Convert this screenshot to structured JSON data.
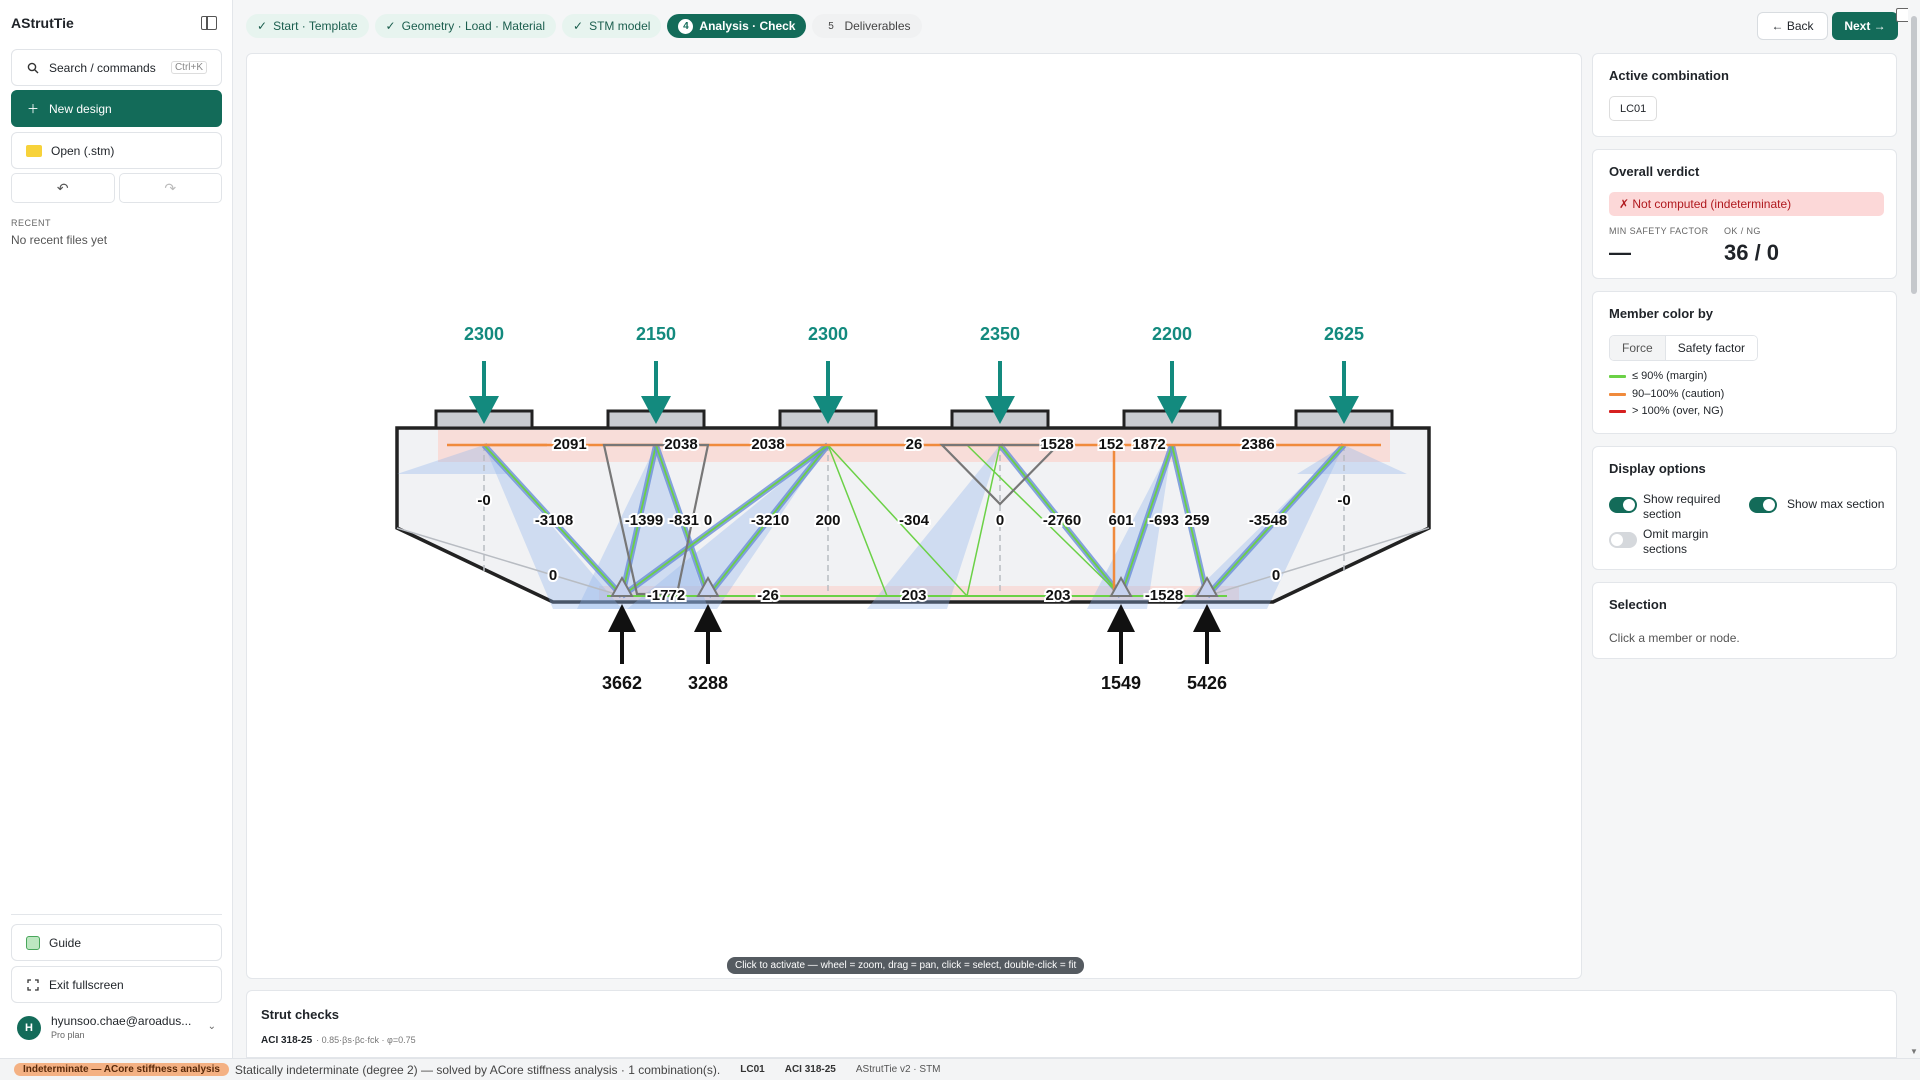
{
  "sidebar": {
    "brand": "AStrutTie",
    "search_label": "Search / commands",
    "search_shortcut": "Ctrl+K",
    "new_design_label": "New design",
    "open_label": "Open (.stm)",
    "recent_heading": "RECENT",
    "recent_empty": "No recent files yet",
    "guide_label": "Guide",
    "exit_fullscreen_label": "Exit fullscreen",
    "user": {
      "initial": "H",
      "email": "hyunsoo.chae@aroadus...",
      "plan": "Pro plan"
    }
  },
  "steps": [
    {
      "label": "Start · Template",
      "mark": "✓",
      "state": "done"
    },
    {
      "label": "Geometry · Load · Material",
      "mark": "✓",
      "state": "done"
    },
    {
      "label": "STM model",
      "mark": "✓",
      "state": "done"
    },
    {
      "label": "Analysis · Check",
      "mark": "4",
      "state": "active"
    },
    {
      "label": "Deliverables",
      "mark": "5",
      "state": "todo"
    }
  ],
  "nav": {
    "back_label": "← Back",
    "next_label": "Next →"
  },
  "canvas": {
    "hint": "Click to activate — wheel = zoom, drag = pan, click = select, double-click = fit",
    "loads": [
      "2300",
      "2150",
      "2300",
      "2350",
      "2200",
      "2625"
    ],
    "reactions": [
      "3662",
      "3288",
      "1549",
      "5426"
    ],
    "top_chord_forces": [
      "2091",
      "2038",
      "2038",
      "26",
      "1528",
      "152",
      "1872",
      "2386"
    ],
    "web_forces": [
      "-0",
      "-3108",
      "-1399",
      "-831",
      "0",
      "-3210",
      "200",
      "-304",
      "0",
      "-2760",
      "601",
      "-693",
      "259",
      "-3548",
      "-0"
    ],
    "bottom_chord_forces": [
      "0",
      "-1772",
      "-26",
      "203",
      "203",
      "-1528",
      "0"
    ]
  },
  "panel": {
    "active_combination": {
      "title": "Active combination",
      "value": "LC01"
    },
    "verdict": {
      "title": "Overall verdict",
      "badge": "✗ Not computed (indeterminate)",
      "min_sf_label": "MIN SAFETY FACTOR",
      "min_sf_value": "—",
      "okng_label": "OK / NG",
      "okng_value": "36 / 0"
    },
    "member_color": {
      "title": "Member color by",
      "options": [
        "Force",
        "Safety factor"
      ],
      "selected": "Safety factor",
      "legend": [
        {
          "label": "≤ 90% (margin)",
          "color": "#6bd146"
        },
        {
          "label": "90–100% (caution)",
          "color": "#f08a3c"
        },
        {
          "label": "> 100% (over, NG)",
          "color": "#d62020"
        }
      ]
    },
    "display_options": {
      "title": "Display options",
      "show_required": "Show required section",
      "show_max": "Show max section",
      "omit_margin": "Omit margin sections"
    },
    "selection": {
      "title": "Selection",
      "hint": "Click a member or node."
    }
  },
  "bottom": {
    "title": "Strut checks",
    "code": "ACI 318-25",
    "formula": "· 0.85·βs·βc·fck · φ=0.75"
  },
  "status": {
    "badge": "Indeterminate — ACore stiffness analysis",
    "message": "Statically indeterminate (degree 2) — solved by ACore stiffness analysis · 1 combination(s).",
    "combo": "LC01",
    "code": "ACI 318-25",
    "app": "AStrutTie v2 · STM"
  },
  "colors": {
    "accent": "#136b59",
    "load_arrow": "#138a7e",
    "tie": "#f08a3c",
    "strut": "#6bd146",
    "ng": "#d62020"
  }
}
